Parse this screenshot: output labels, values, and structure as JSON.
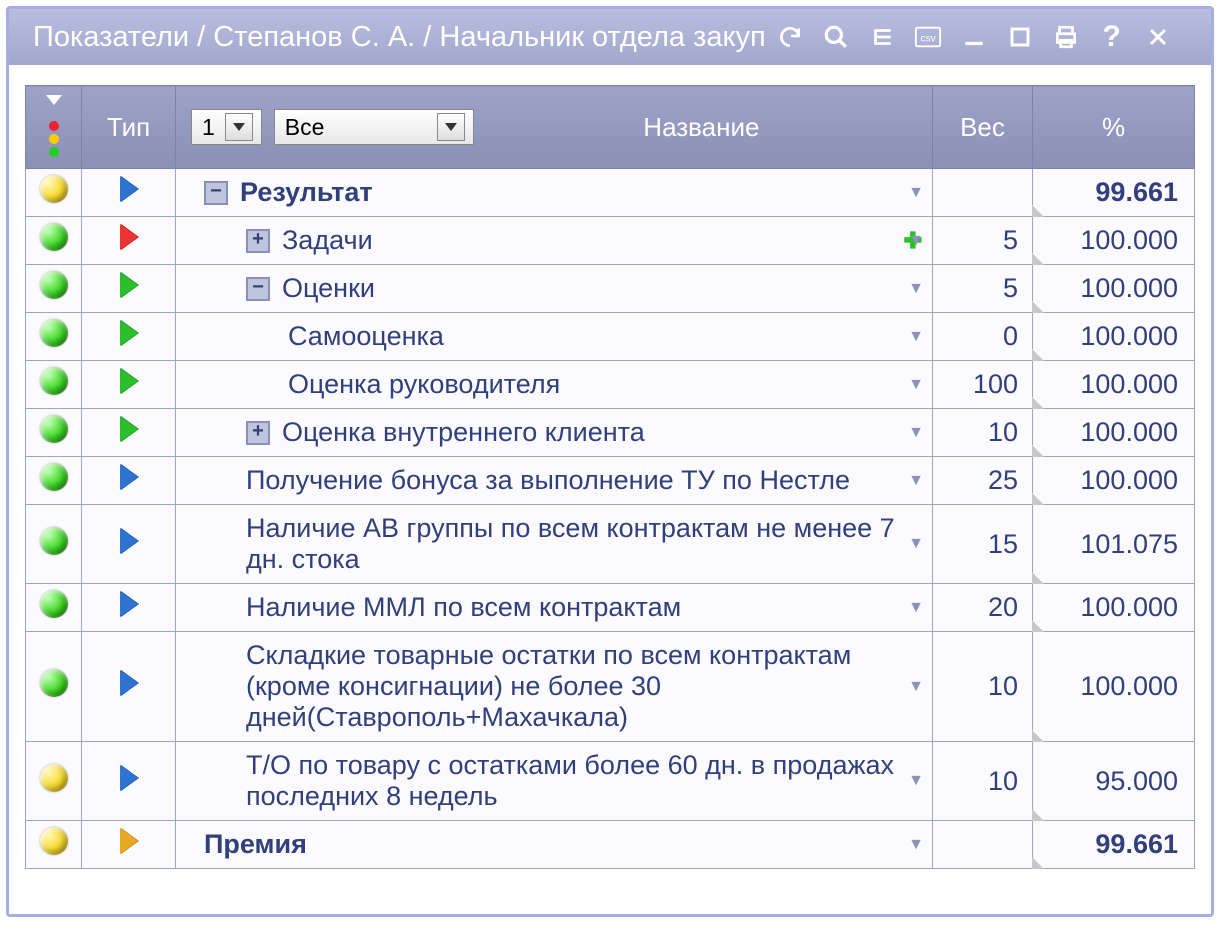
{
  "window_title": "Показатели / Степанов С. А. / Начальник отдела закуп",
  "toolbar": {
    "refresh": "refresh",
    "search": "search",
    "list": "list",
    "export_csv": "csv",
    "minimize": "minimize",
    "maximize": "maximize",
    "print": "print",
    "help": "?",
    "close": "close"
  },
  "headers": {
    "type": "Тип",
    "name": "Название",
    "weight": "Вес",
    "pct": "%",
    "level_dd_value": "1",
    "filter_dd_value": "Все"
  },
  "rows": [
    {
      "status": "yellow",
      "type_arrow": "blue",
      "indent": 0,
      "expander": "minus",
      "label": "Результат",
      "bold": true,
      "weight": "",
      "pct": "99.661",
      "has_add": false
    },
    {
      "status": "green",
      "type_arrow": "red",
      "indent": 1,
      "expander": "plus",
      "label": "Задачи",
      "bold": false,
      "weight": "5",
      "pct": "100.000",
      "has_add": true
    },
    {
      "status": "green",
      "type_arrow": "green",
      "indent": 1,
      "expander": "minus",
      "label": "Оценки",
      "bold": false,
      "weight": "5",
      "pct": "100.000",
      "has_add": false
    },
    {
      "status": "green",
      "type_arrow": "green",
      "indent": 2,
      "expander": "",
      "label": "Самооценка",
      "bold": false,
      "weight": "0",
      "pct": "100.000",
      "has_add": false
    },
    {
      "status": "green",
      "type_arrow": "green",
      "indent": 2,
      "expander": "",
      "label": "Оценка руководителя",
      "bold": false,
      "weight": "100",
      "pct": "100.000",
      "has_add": false
    },
    {
      "status": "green",
      "type_arrow": "green",
      "indent": 1,
      "expander": "plus",
      "label": "Оценка внутреннего клиента",
      "bold": false,
      "weight": "10",
      "pct": "100.000",
      "has_add": false
    },
    {
      "status": "green",
      "type_arrow": "blue",
      "indent": 1,
      "expander": "",
      "label": "Получение бонуса за выполнение ТУ по Нестле",
      "bold": false,
      "weight": "25",
      "pct": "100.000",
      "has_add": false
    },
    {
      "status": "green",
      "type_arrow": "blue",
      "indent": 1,
      "expander": "",
      "label": "Наличие АВ группы по всем контрактам не менее 7 дн. стока",
      "bold": false,
      "weight": "15",
      "pct": "101.075",
      "has_add": false
    },
    {
      "status": "green",
      "type_arrow": "blue",
      "indent": 1,
      "expander": "",
      "label": "Наличие ММЛ по всем контрактам",
      "bold": false,
      "weight": "20",
      "pct": "100.000",
      "has_add": false
    },
    {
      "status": "green",
      "type_arrow": "blue",
      "indent": 1,
      "expander": "",
      "label": "Складкие товарные остатки по всем контрактам (кроме консигнации) не более 30 дней(Ставрополь+Махачкала)",
      "bold": false,
      "weight": "10",
      "pct": "100.000",
      "has_add": false
    },
    {
      "status": "yellow",
      "type_arrow": "blue",
      "indent": 1,
      "expander": "",
      "label": "Т/О по товару с остатками более 60 дн. в продажах последних 8 недель",
      "bold": false,
      "weight": "10",
      "pct": "95.000",
      "has_add": false
    },
    {
      "status": "yellow",
      "type_arrow": "amber",
      "indent": 0,
      "expander": "",
      "label": "Премия",
      "bold": true,
      "weight": "",
      "pct": "99.661",
      "has_add": false
    }
  ]
}
